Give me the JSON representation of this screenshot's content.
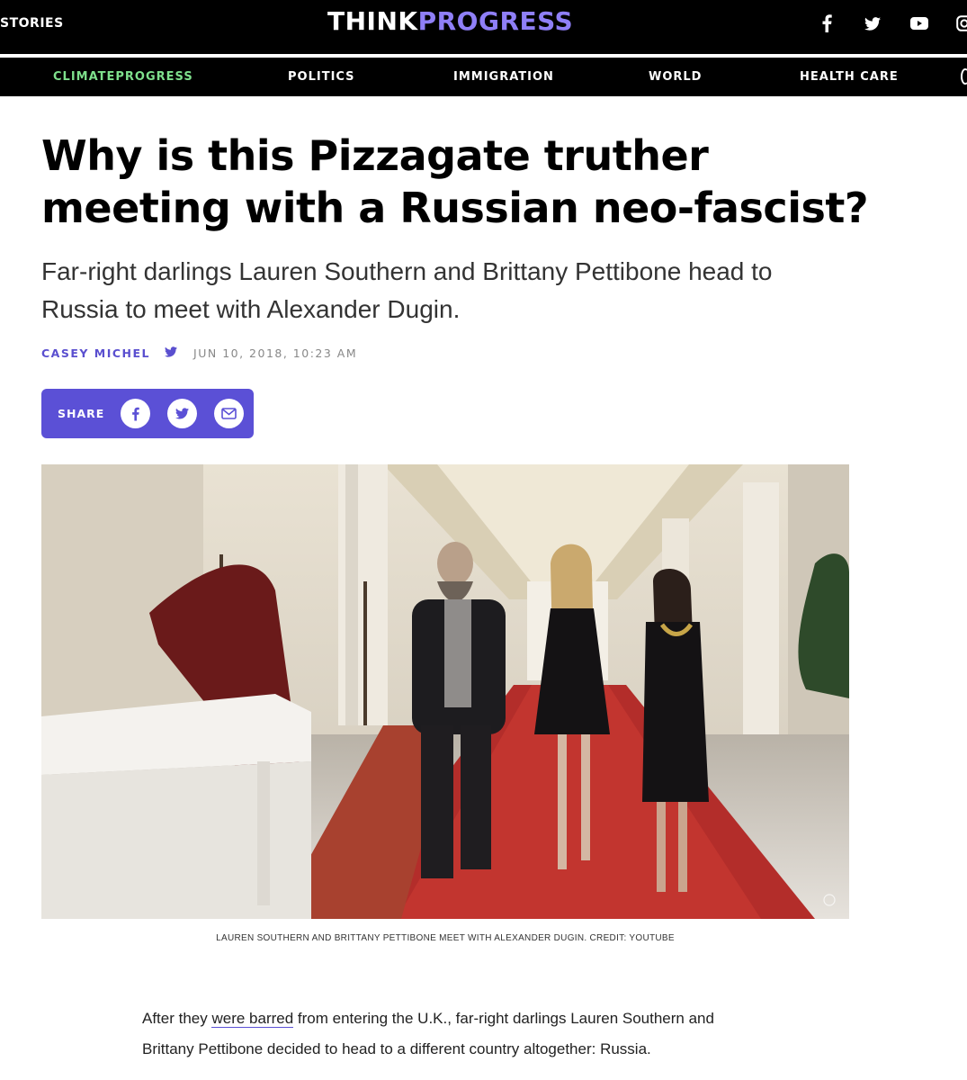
{
  "header": {
    "stories_label": "STORIES",
    "logo": {
      "think": "THINK",
      "progress": "PROGRESS"
    },
    "social_icons": [
      "facebook-icon",
      "twitter-icon",
      "youtube-icon",
      "instagram-icon"
    ]
  },
  "nav": {
    "items": [
      {
        "label": "CLIMATEPROGRESS"
      },
      {
        "label": "POLITICS"
      },
      {
        "label": "IMMIGRATION"
      },
      {
        "label": "WORLD"
      },
      {
        "label": "HEALTH CARE"
      }
    ]
  },
  "article": {
    "headline": "Why is this Pizzagate truther meeting with a Russian neo-fascist?",
    "subhead": "Far-right darlings Lauren Southern and Brittany Pettibone head to Russia to meet with Alexander Dugin.",
    "author": "CASEY MICHEL",
    "date": "JUN 10, 2018, 10:23 AM",
    "share_label": "SHARE",
    "caption": "LAUREN SOUTHERN AND BRITTANY PETTIBONE MEET WITH ALEXANDER DUGIN. CREDIT: YOUTUBE",
    "body": {
      "before_link": "After they ",
      "link_text": "were barred",
      "after_link": " from entering the U.K., far-right darlings Lauren Southern and Brittany Pettibone decided to head to a different country altogether: Russia."
    }
  },
  "colors": {
    "accent": "#5b50d6",
    "logo_purple": "#8f7ff7",
    "climate_green": "#7ee08c",
    "nav_bg": "#000000"
  }
}
